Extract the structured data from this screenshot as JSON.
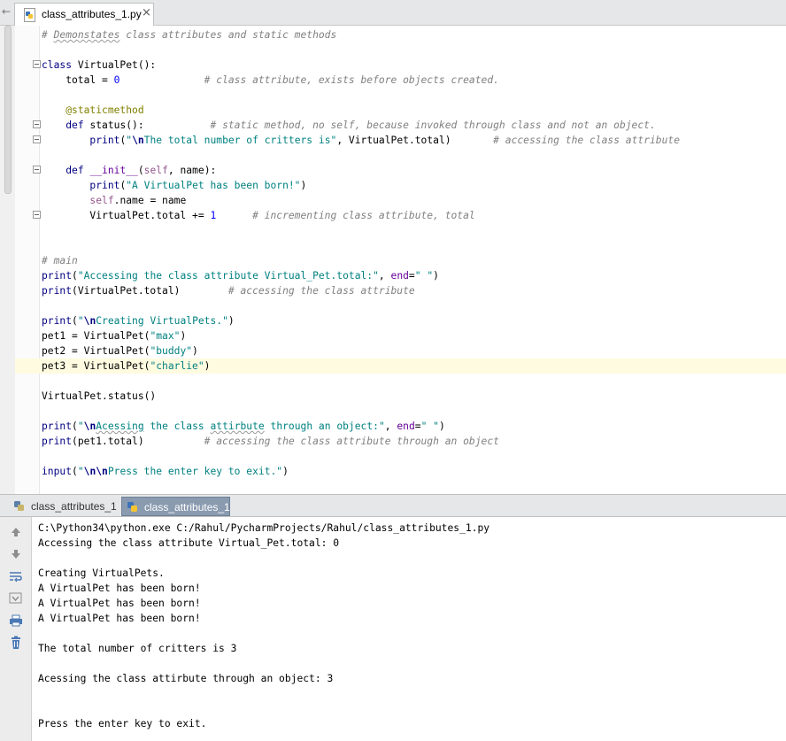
{
  "tab": {
    "filename": "class_attributes_1.py",
    "close_glyph": "×",
    "back_glyph": "←",
    "icon": "python-file-icon"
  },
  "editor": {
    "code_lines": [
      {
        "n": 1,
        "tokens": [
          {
            "t": "# ",
            "k": "cm"
          },
          {
            "t": "Demonstates",
            "k": "cm typo"
          },
          {
            "t": " class attributes and static methods",
            "k": "cm"
          }
        ]
      },
      {
        "n": 2,
        "tokens": []
      },
      {
        "n": 3,
        "tokens": [
          {
            "t": "class ",
            "k": "kw"
          },
          {
            "t": "VirtualPet():",
            "k": ""
          }
        ]
      },
      {
        "n": 4,
        "tokens": [
          {
            "t": "    total = ",
            "k": ""
          },
          {
            "t": "0",
            "k": "nm"
          },
          {
            "t": "              ",
            "k": ""
          },
          {
            "t": "# class attribute, exists before objects created.",
            "k": "cm"
          }
        ]
      },
      {
        "n": 5,
        "tokens": []
      },
      {
        "n": 6,
        "tokens": [
          {
            "t": "    ",
            "k": ""
          },
          {
            "t": "@staticmethod",
            "k": "dc"
          }
        ]
      },
      {
        "n": 7,
        "tokens": [
          {
            "t": "    ",
            "k": ""
          },
          {
            "t": "def ",
            "k": "kw"
          },
          {
            "t": "status():           ",
            "k": ""
          },
          {
            "t": "# static method, no self, because invoked through class and not an object.",
            "k": "cm"
          }
        ]
      },
      {
        "n": 8,
        "tokens": [
          {
            "t": "        ",
            "k": ""
          },
          {
            "t": "print",
            "k": "kw"
          },
          {
            "t": "(",
            "k": ""
          },
          {
            "t": "\"",
            "k": "st"
          },
          {
            "t": "\\n",
            "k": "es"
          },
          {
            "t": "The total number of critters is\"",
            "k": "st"
          },
          {
            "t": ", VirtualPet.total)       ",
            "k": ""
          },
          {
            "t": "# accessing the class attribute",
            "k": "cm"
          }
        ]
      },
      {
        "n": 9,
        "tokens": []
      },
      {
        "n": 10,
        "tokens": [
          {
            "t": "    ",
            "k": ""
          },
          {
            "t": "def ",
            "k": "kw"
          },
          {
            "t": "__init__",
            "k": "kv"
          },
          {
            "t": "(",
            "k": ""
          },
          {
            "t": "self",
            "k": "sf"
          },
          {
            "t": ", name):",
            "k": ""
          }
        ]
      },
      {
        "n": 11,
        "tokens": [
          {
            "t": "        ",
            "k": ""
          },
          {
            "t": "print",
            "k": "kw"
          },
          {
            "t": "(",
            "k": ""
          },
          {
            "t": "\"A VirtualPet has been born!\"",
            "k": "st"
          },
          {
            "t": ")",
            "k": ""
          }
        ]
      },
      {
        "n": 12,
        "tokens": [
          {
            "t": "        ",
            "k": ""
          },
          {
            "t": "self",
            "k": "sf"
          },
          {
            "t": ".name = name",
            "k": ""
          }
        ]
      },
      {
        "n": 13,
        "tokens": [
          {
            "t": "        VirtualPet.total += ",
            "k": ""
          },
          {
            "t": "1",
            "k": "nm"
          },
          {
            "t": "      ",
            "k": ""
          },
          {
            "t": "# incrementing class attribute, total",
            "k": "cm"
          }
        ]
      },
      {
        "n": 14,
        "tokens": []
      },
      {
        "n": 15,
        "tokens": []
      },
      {
        "n": 16,
        "tokens": [
          {
            "t": "# main",
            "k": "cm"
          }
        ]
      },
      {
        "n": 17,
        "tokens": [
          {
            "t": "print",
            "k": "kw"
          },
          {
            "t": "(",
            "k": ""
          },
          {
            "t": "\"Accessing the class attribute Virtual_Pet.total:\"",
            "k": "st"
          },
          {
            "t": ", ",
            "k": ""
          },
          {
            "t": "end",
            "k": "kv"
          },
          {
            "t": "=",
            "k": ""
          },
          {
            "t": "\" \"",
            "k": "st"
          },
          {
            "t": ")",
            "k": ""
          }
        ]
      },
      {
        "n": 18,
        "tokens": [
          {
            "t": "print",
            "k": "kw"
          },
          {
            "t": "(VirtualPet.total)        ",
            "k": ""
          },
          {
            "t": "# accessing the class attribute",
            "k": "cm"
          }
        ]
      },
      {
        "n": 19,
        "tokens": []
      },
      {
        "n": 20,
        "tokens": [
          {
            "t": "print",
            "k": "kw"
          },
          {
            "t": "(",
            "k": ""
          },
          {
            "t": "\"",
            "k": "st"
          },
          {
            "t": "\\n",
            "k": "es"
          },
          {
            "t": "Creating VirtualPets.\"",
            "k": "st"
          },
          {
            "t": ")",
            "k": ""
          }
        ]
      },
      {
        "n": 21,
        "tokens": [
          {
            "t": "pet1 = VirtualPet(",
            "k": ""
          },
          {
            "t": "\"max\"",
            "k": "st"
          },
          {
            "t": ")",
            "k": ""
          }
        ]
      },
      {
        "n": 22,
        "tokens": [
          {
            "t": "pet2 = VirtualPet(",
            "k": ""
          },
          {
            "t": "\"buddy\"",
            "k": "st"
          },
          {
            "t": ")",
            "k": ""
          }
        ]
      },
      {
        "n": 23,
        "tokens": [
          {
            "t": "pet3 = VirtualPet(",
            "k": ""
          },
          {
            "t": "\"charlie\"",
            "k": "st"
          },
          {
            "t": ")",
            "k": ""
          }
        ],
        "current": true
      },
      {
        "n": 24,
        "tokens": []
      },
      {
        "n": 25,
        "tokens": [
          {
            "t": "VirtualPet.status()",
            "k": ""
          }
        ]
      },
      {
        "n": 26,
        "tokens": []
      },
      {
        "n": 27,
        "tokens": [
          {
            "t": "print",
            "k": "kw"
          },
          {
            "t": "(",
            "k": ""
          },
          {
            "t": "\"",
            "k": "st"
          },
          {
            "t": "\\n",
            "k": "es"
          },
          {
            "t": "Acessing",
            "k": "st typo"
          },
          {
            "t": " the class ",
            "k": "st"
          },
          {
            "t": "attirbute",
            "k": "st typo"
          },
          {
            "t": " through an object:\"",
            "k": "st"
          },
          {
            "t": ", ",
            "k": ""
          },
          {
            "t": "end",
            "k": "kv"
          },
          {
            "t": "=",
            "k": ""
          },
          {
            "t": "\" \"",
            "k": "st"
          },
          {
            "t": ")",
            "k": ""
          }
        ]
      },
      {
        "n": 28,
        "tokens": [
          {
            "t": "print",
            "k": "kw"
          },
          {
            "t": "(pet1.total)          ",
            "k": ""
          },
          {
            "t": "# accessing the class attribute through an object",
            "k": "cm"
          }
        ]
      },
      {
        "n": 29,
        "tokens": []
      },
      {
        "n": 30,
        "tokens": [
          {
            "t": "input",
            "k": "kw"
          },
          {
            "t": "(",
            "k": ""
          },
          {
            "t": "\"",
            "k": "st"
          },
          {
            "t": "\\n\\n",
            "k": "es"
          },
          {
            "t": "Press the enter key to exit.\"",
            "k": "st"
          },
          {
            "t": ")",
            "k": ""
          }
        ]
      }
    ]
  },
  "run_tabs": [
    {
      "label": "class_attributes_1",
      "active": false
    },
    {
      "label": "class_attributes_1",
      "active": true
    }
  ],
  "console": {
    "lines": [
      "C:\\Python34\\python.exe C:/Rahul/PycharmProjects/Rahul/class_attributes_1.py",
      "Accessing the class attribute Virtual_Pet.total: 0",
      "",
      "Creating VirtualPets.",
      "A VirtualPet has been born!",
      "A VirtualPet has been born!",
      "A VirtualPet has been born!",
      "",
      "The total number of critters is 3",
      "",
      "Acessing the class attirbute through an object: 3",
      "",
      "",
      "Press the enter key to exit."
    ],
    "toolbar_icons": [
      "arrow-up-icon",
      "arrow-down-icon",
      "soft-wrap-icon",
      "scroll-to-end-icon",
      "print-icon",
      "trash-icon"
    ]
  },
  "colors": {
    "keyword": "#000080",
    "string": "#008080",
    "comment": "#808080",
    "number": "#0000ff",
    "decorator": "#808000",
    "self": "#94558d",
    "current_line": "#fffbe0",
    "active_run_tab": "#8a9bb0"
  }
}
